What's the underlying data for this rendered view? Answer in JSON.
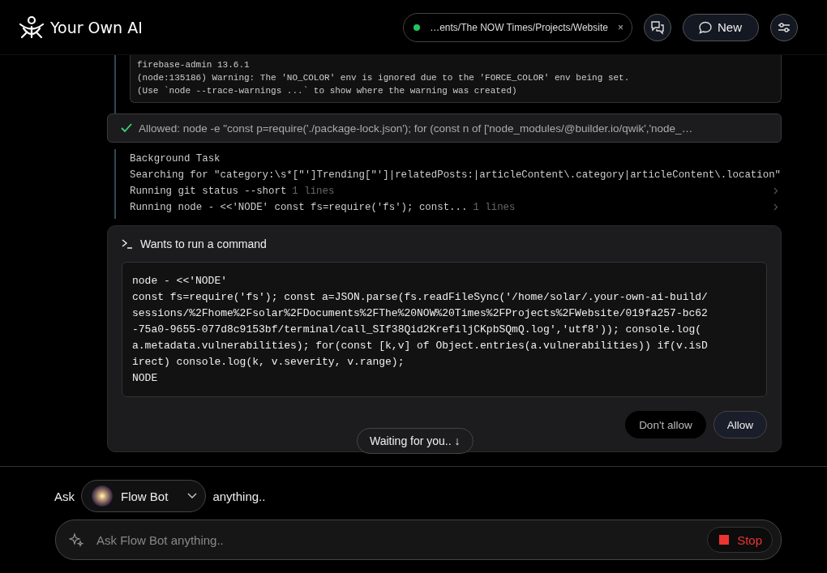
{
  "header": {
    "brand": "Your Own AI",
    "project": {
      "path": "…ents/The NOW Times/Projects/Website",
      "close": "×",
      "connected": true
    },
    "new_button": "New"
  },
  "output_block": {
    "lines": [
      "firebase-admin 13.6.1",
      "(node:135186) Warning: The 'NO_COLOR' env is ignored due to the 'FORCE_COLOR' env being set.",
      "(Use `node --trace-warnings ...` to show where the warning was created)"
    ]
  },
  "allowed": {
    "text": "Allowed: node -e \"const p=require('./package-lock.json'); for (const n of ['node_modules/@builder.io/qwik','node_…"
  },
  "tasks": [
    {
      "text": "Background Task",
      "expandable": false
    },
    {
      "text": "Searching for \"category:\\s*[\"']Trending[\"']|relatedPosts:|articleContent\\.category|articleContent\\.location\"",
      "expandable": false
    },
    {
      "text": "Running git status --short",
      "count": "1 lines",
      "expandable": true
    },
    {
      "text": "Running node - <<'NODE' const fs=require('fs'); const...",
      "count": "1 lines",
      "expandable": true
    }
  ],
  "permission": {
    "title": "Wants to run a command",
    "code_lines": [
      "node - <<'NODE'",
      "const fs=require('fs'); const a=JSON.parse(fs.readFileSync('/home/solar/.your-own-ai-build/",
      "sessions/%2Fhome%2Fsolar%2FDocuments%2FThe%20NOW%20Times%2FProjects%2FWebsite/019fa257-bc62",
      "-75a0-9655-077d8c9153bf/terminal/call_SIf38Qid2KrefiljCKpbSQmQ.log','utf8')); console.log(",
      "a.metadata.vulnerabilities); for(const [k,v] of Object.entries(a.vulnerabilities)) if(v.isD",
      "irect) console.log(k, v.severity, v.range);",
      "NODE"
    ],
    "buttons": [
      "Don't allow",
      "Allow"
    ]
  },
  "waiting_pill": "Waiting for you.. ↓",
  "composer": {
    "prefix": "Ask",
    "agent": "Flow Bot",
    "suffix": "anything..",
    "placeholder": "Ask Flow Bot anything..",
    "stop": "Stop"
  }
}
